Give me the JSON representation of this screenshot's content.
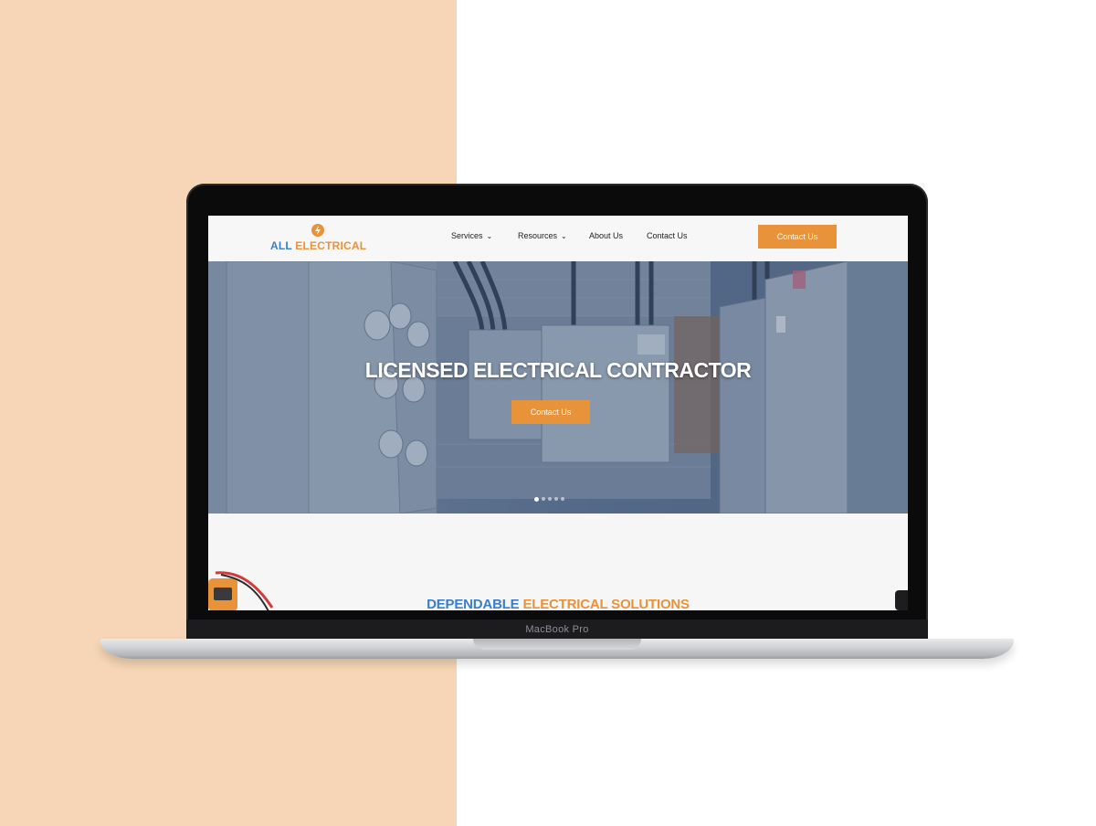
{
  "colors": {
    "left_background": "#f6d6b6",
    "accent_orange": "#e8923a",
    "accent_blue": "#3b7ec9"
  },
  "device": {
    "label": "MacBook Pro"
  },
  "site": {
    "logo": {
      "icon": "lightning-bolt-icon",
      "word1": "ALL",
      "word2": "ELECTRICAL"
    },
    "nav": [
      {
        "label": "Services",
        "has_dropdown": true
      },
      {
        "label": "Resources",
        "has_dropdown": true
      },
      {
        "label": "About Us",
        "has_dropdown": false
      },
      {
        "label": "Contact Us",
        "has_dropdown": false
      }
    ],
    "header_cta": "Contact Us",
    "hero": {
      "title": "LICENSED ELECTRICAL CONTRACTOR",
      "cta": "Contact Us",
      "slides_count": 5,
      "active_slide": 1
    },
    "section": {
      "title_part1": "DEPENDABLE",
      "title_part2": "ELECTRICAL SOLUTIONS"
    }
  }
}
